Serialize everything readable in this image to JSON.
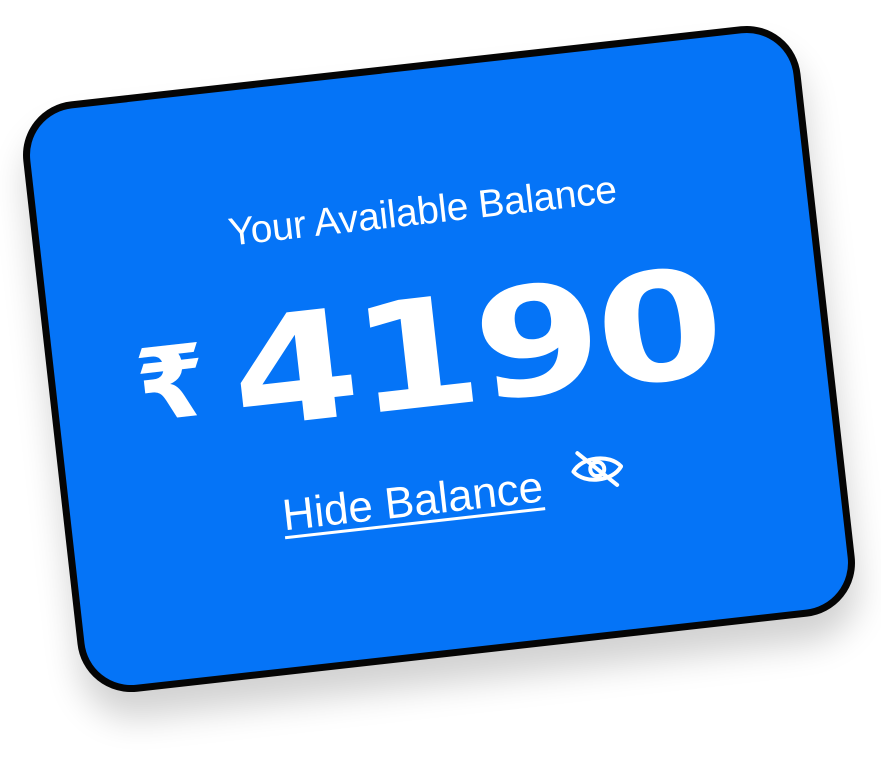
{
  "balance_card": {
    "subtitle": "Your Available Balance",
    "currency_symbol": "₹",
    "amount": "4190",
    "hide_label": "Hide Balance",
    "toggle_icon": "eye-off-icon",
    "background_color": "#0574f7",
    "border_color": "#050505",
    "text_color": "#ffffff"
  }
}
